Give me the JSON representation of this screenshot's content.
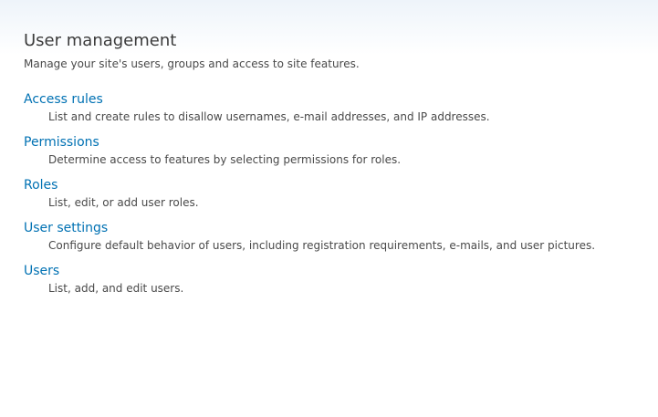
{
  "section": {
    "title": "User management",
    "description": "Manage your site's users, groups and access to site features."
  },
  "items": [
    {
      "label": "Access rules",
      "description": "List and create rules to disallow usernames, e-mail addresses, and IP addresses."
    },
    {
      "label": "Permissions",
      "description": "Determine access to features by selecting permissions for roles."
    },
    {
      "label": "Roles",
      "description": "List, edit, or add user roles."
    },
    {
      "label": "User settings",
      "description": "Configure default behavior of users, including registration requirements, e-mails, and user pictures."
    },
    {
      "label": "Users",
      "description": "List, add, and edit users."
    }
  ],
  "colors": {
    "link": "#0071b3",
    "text": "#494949",
    "title": "#3b3b3b"
  }
}
